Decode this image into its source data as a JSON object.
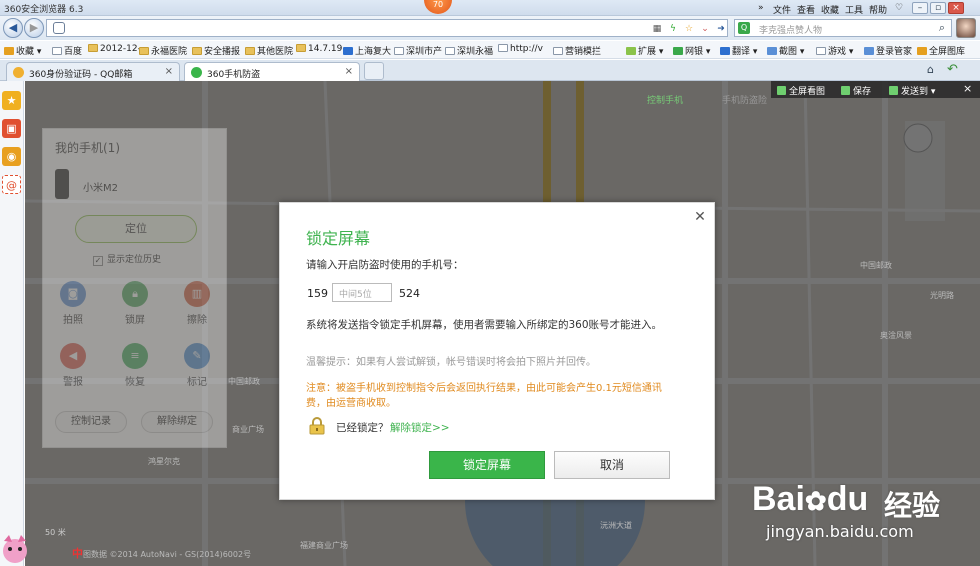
{
  "browser": {
    "title": "360安全浏览器 6.3",
    "badge": "70",
    "menu": [
      "文件",
      "查看",
      "收藏",
      "工具",
      "帮助"
    ],
    "search_placeholder": "李克强点赞人物"
  },
  "bookmarks": [
    "收藏",
    "百度",
    "2012-12-",
    "永福医院",
    "安全播报",
    "其他医院",
    "14.7.19",
    "上海复大",
    "深圳市产",
    "深圳永福",
    "http://v",
    "营销模拦"
  ],
  "bookmark_tools": [
    "扩展",
    "网银",
    "翻译",
    "截图",
    "游戏",
    "登录管家",
    "全屏图库"
  ],
  "tabs": [
    {
      "label": "360身份验证码 - QQ邮箱"
    },
    {
      "label": "360手机防盗"
    }
  ],
  "map_toolbar": [
    "全屏看图",
    "保存",
    "发送到"
  ],
  "map_header": {
    "nav1": "控制手机",
    "nav2": "手机防盗险"
  },
  "panel": {
    "title": "我的手机(1)",
    "device": "小米M2",
    "locate": "定位",
    "history": "显示定位历史",
    "actions": [
      {
        "label": "拍照",
        "icon": "camera-icon",
        "color": "#5a8fd6"
      },
      {
        "label": "锁屏",
        "icon": "lock-icon",
        "color": "#4aa85a"
      },
      {
        "label": "擦除",
        "icon": "trash-icon",
        "color": "#d65a3a"
      },
      {
        "label": "警报",
        "icon": "speaker-icon",
        "color": "#e0574a"
      },
      {
        "label": "恢复",
        "icon": "restore-icon",
        "color": "#3fae5a"
      },
      {
        "label": "标记",
        "icon": "pen-icon",
        "color": "#4a8fd6"
      }
    ],
    "control_log": "控制记录",
    "unbind": "解除绑定"
  },
  "map_labels": [
    {
      "text": "中国邮政"
    },
    {
      "text": "商业广场"
    },
    {
      "text": "鸿星尔克"
    },
    {
      "text": "光明路"
    },
    {
      "text": "中国邮政"
    },
    {
      "text": "奥淦风景"
    },
    {
      "text": "沅洲大道"
    },
    {
      "text": "福建商业广场"
    }
  ],
  "dialog": {
    "title": "锁定屏幕",
    "prompt": "请输入开启防盗时使用的手机号：",
    "prefix": "159",
    "mid_placeholder": "中间5位",
    "suffix": "524",
    "info": "系统将发送指令锁定手机屏幕，使用者需要输入所绑定的360账号才能进入。",
    "tip": "温馨提示：如果有人尝试解锁，帐号错误时将会拍下照片并回传。",
    "warning": "注意：被盗手机收到控制指令后会返回执行结果，由此可能会产生0.1元短信通讯费，由运营商收取。",
    "locked_q": "已经锁定？",
    "unlock_link": "解除锁定>>",
    "ok": "锁定屏幕",
    "cancel": "取消"
  },
  "watermark": {
    "logo": "Bai",
    "logo2": "du",
    "text": "经验",
    "url": "jingyan.baidu.com"
  },
  "map_footer": {
    "scale": "50 米",
    "brand": "中",
    "copyright": "图数据 ©2014 AutoNavi - GS(2014)6002号"
  }
}
